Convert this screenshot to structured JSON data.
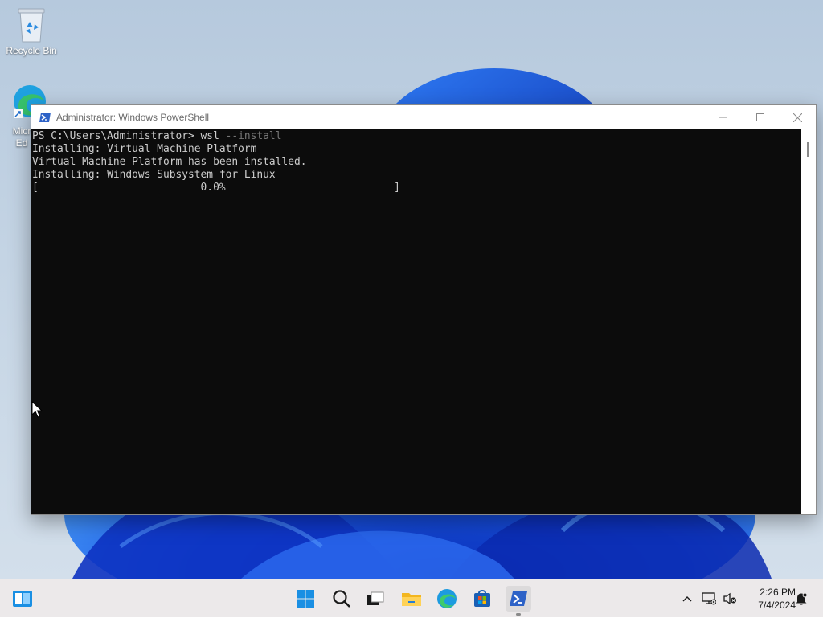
{
  "desktop": {
    "icons": [
      {
        "label": "Recycle Bin",
        "icon": "recycle-bin-icon"
      },
      {
        "label": "Micr\nEd",
        "icon": "edge-icon"
      }
    ]
  },
  "window": {
    "title": "Administrator: Windows PowerShell",
    "app_icon": "powershell-icon",
    "controls": {
      "minimize": "minimize-icon",
      "maximize": "maximize-icon",
      "close": "close-icon"
    }
  },
  "console": {
    "prompt": "PS C:\\Users\\Administrator> ",
    "command": "wsl",
    "argument": " --install",
    "lines": [
      "Installing: Virtual Machine Platform",
      "Virtual Machine Platform has been installed.",
      "Installing: Windows Subsystem for Linux",
      "[                          0.0%                           ]"
    ],
    "progress_percent": 0.0
  },
  "taskbar": {
    "apps": [
      {
        "name": "Start",
        "icon": "windows-start-icon"
      },
      {
        "name": "Search",
        "icon": "search-icon"
      },
      {
        "name": "Task View",
        "icon": "task-view-icon"
      },
      {
        "name": "File Explorer",
        "icon": "folder-icon"
      },
      {
        "name": "Microsoft Edge",
        "icon": "edge-icon"
      },
      {
        "name": "Microsoft Store",
        "icon": "store-icon"
      },
      {
        "name": "Windows PowerShell",
        "icon": "powershell-icon",
        "active": true
      }
    ],
    "widgets_icon": "widgets-icon",
    "tray": {
      "chevron": "chevron-up-icon",
      "network": "network-icon",
      "volume": "volume-muted-icon",
      "notifications": "notification-icon"
    },
    "time": "2:26 PM",
    "date": "7/4/2024"
  },
  "colors": {
    "console_bg": "#0c0c0c",
    "console_text": "#cccccc",
    "console_param": "#767676",
    "accent": "#0067c0"
  }
}
